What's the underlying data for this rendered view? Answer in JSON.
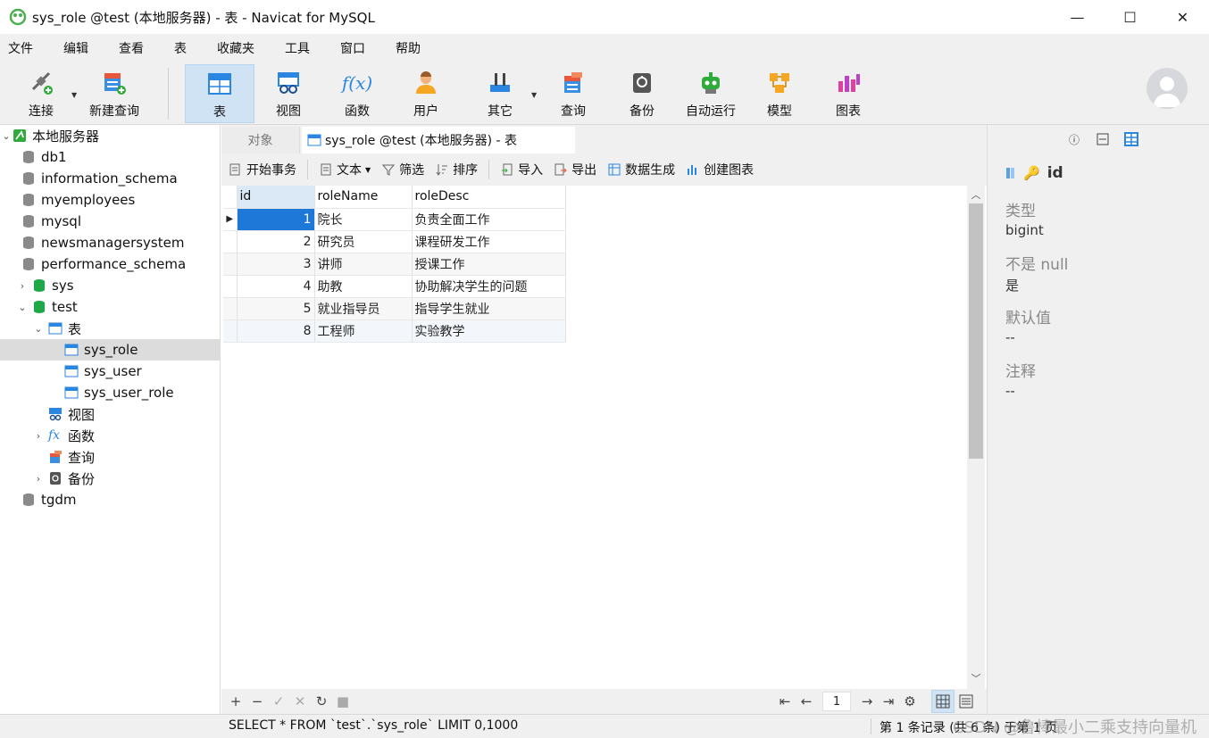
{
  "window": {
    "title": "sys_role @test (本地服务器) - 表 - Navicat for MySQL",
    "controls": {
      "minimize": "—",
      "maximize": "☐",
      "close": "✕"
    }
  },
  "menu": [
    "文件",
    "编辑",
    "查看",
    "表",
    "收藏夹",
    "工具",
    "窗口",
    "帮助"
  ],
  "toolbar": {
    "buttons": [
      {
        "label": "连接",
        "icon": "connect-icon"
      },
      {
        "label": "新建查询",
        "icon": "new-query-icon"
      },
      {
        "label": "表",
        "icon": "table-icon",
        "active": true
      },
      {
        "label": "视图",
        "icon": "view-icon"
      },
      {
        "label": "函数",
        "icon": "function-icon"
      },
      {
        "label": "用户",
        "icon": "user-icon"
      },
      {
        "label": "其它",
        "icon": "tools-icon"
      },
      {
        "label": "查询",
        "icon": "query-icon"
      },
      {
        "label": "备份",
        "icon": "backup-icon"
      },
      {
        "label": "自动运行",
        "icon": "robot-icon"
      },
      {
        "label": "模型",
        "icon": "model-icon"
      },
      {
        "label": "图表",
        "icon": "chart-icon"
      }
    ]
  },
  "tree": {
    "root": "本地服务器",
    "databases": [
      "db1",
      "information_schema",
      "myemployees",
      "mysql",
      "newsmanagersystem",
      "performance_schema",
      "sys",
      "test"
    ],
    "test_children": {
      "tables_label": "表",
      "tables": [
        "sys_role",
        "sys_user",
        "sys_user_role"
      ],
      "views": "视图",
      "functions": "函数",
      "queries": "查询",
      "backups": "备份"
    },
    "last_db": "tgdm"
  },
  "tabs": {
    "objects": "对象",
    "current": "sys_role @test (本地服务器) - 表"
  },
  "subtoolbar": {
    "begin_tx": "开始事务",
    "text": "文本",
    "filter": "筛选",
    "sort": "排序",
    "import": "导入",
    "export": "导出",
    "datagen": "数据生成",
    "create_chart": "创建图表"
  },
  "grid": {
    "columns": [
      "id",
      "roleName",
      "roleDesc"
    ],
    "rows": [
      {
        "id": "1",
        "roleName": "院长",
        "roleDesc": "负责全面工作"
      },
      {
        "id": "2",
        "roleName": "研究员",
        "roleDesc": "课程研发工作"
      },
      {
        "id": "3",
        "roleName": "讲师",
        "roleDesc": "授课工作"
      },
      {
        "id": "4",
        "roleName": "助教",
        "roleDesc": "协助解决学生的问题"
      },
      {
        "id": "5",
        "roleName": "就业指导员",
        "roleDesc": "指导学生就业"
      },
      {
        "id": "8",
        "roleName": "工程师",
        "roleDesc": "实验教学"
      }
    ]
  },
  "bottombar": {
    "add": "+",
    "remove": "−",
    "apply": "✓",
    "cancel": "✕",
    "refresh": "↻",
    "stop": "■",
    "first": "⇤",
    "prev": "←",
    "page": "1",
    "next": "→",
    "last": "⇥",
    "settings": "⚙"
  },
  "rpanel": {
    "field_name": "id",
    "type_label": "类型",
    "type_value": "bigint",
    "notnull_label": "不是 null",
    "notnull_value": "是",
    "default_label": "默认值",
    "default_value": "--",
    "comment_label": "注释",
    "comment_value": "--"
  },
  "status": {
    "sql": "SELECT * FROM `test`.`sys_role` LIMIT 0,1000",
    "records": "第 1 条记录 (共 6 条) 于第 1 页",
    "watermark": "CSDN @鲁棒最小二乘支持向量机"
  },
  "colors": {
    "accent": "#1e78d7",
    "active_bg": "#cfe3f5",
    "db_green": "#1fa84a",
    "db_gray": "#8a8a8a"
  }
}
